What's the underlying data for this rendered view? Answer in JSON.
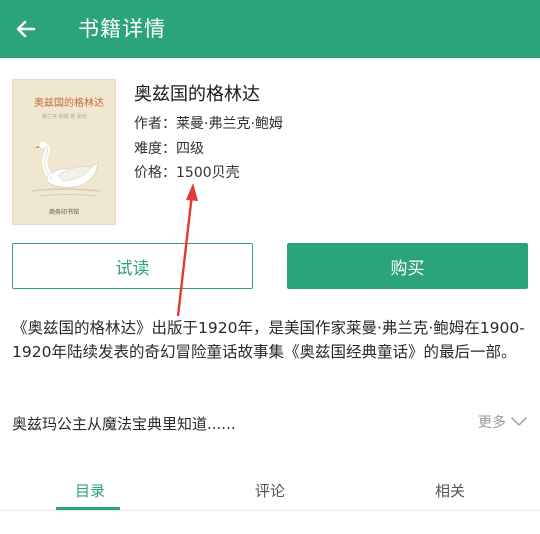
{
  "appbar": {
    "title": "书籍详情",
    "back_icon": "arrow-left-icon",
    "color": "#2aa478"
  },
  "book": {
    "title": "奥兹国的格林达",
    "author_line": "作者：莱曼·弗兰克·鲍姆",
    "level_line": "难度：四级",
    "price_line": "价格：1500贝壳",
    "cover": {
      "title": "奥兹国的格林达",
      "subtitle": "弗兰克·鲍姆 著  夏晓",
      "publisher": "商务印书馆"
    }
  },
  "actions": {
    "trial_label": "试读",
    "buy_label": "购买"
  },
  "description": "《奥兹国的格林达》出版于1920年，是美国作家莱曼·弗兰克·鲍姆在1900-1920年陆续发表的奇幻冒险童话故事集《奥兹国经典童话》的最后一部。",
  "teaser": "奥兹玛公主从魔法宝典里知道......",
  "more_label": "更多",
  "tabs": [
    {
      "label": "目录",
      "active": true
    },
    {
      "label": "评论",
      "active": false
    },
    {
      "label": "相关",
      "active": false
    }
  ],
  "annotation_color": "#e53935"
}
